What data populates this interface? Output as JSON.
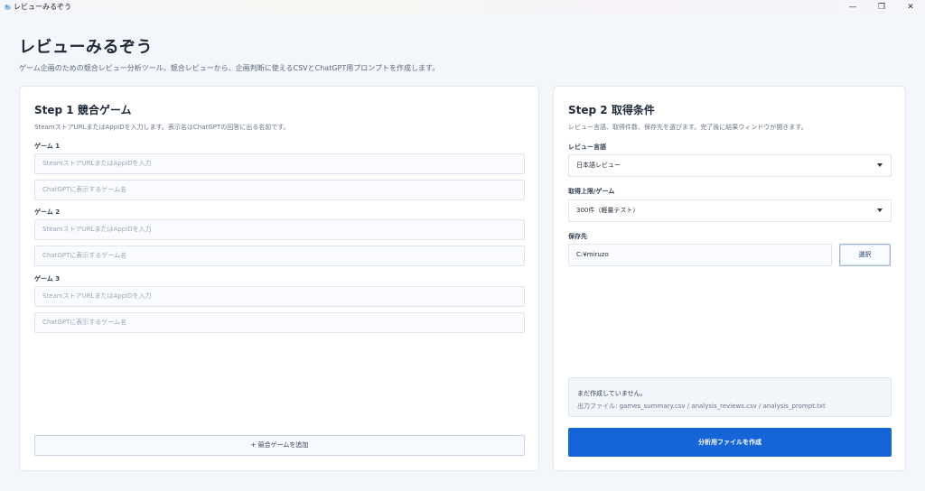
{
  "window": {
    "title": "レビューみるぞう",
    "minimize_glyph": "—",
    "maximize_glyph": "❐",
    "close_glyph": "✕"
  },
  "header": {
    "title": "レビューみるぞう",
    "subtitle": "ゲーム企画のための競合レビュー分析ツール。競合レビューから、企画判断に使えるCSVとChatGPT用プロンプトを作成します。"
  },
  "step1": {
    "title": "Step 1 競合ゲーム",
    "description": "SteamストアURLまたはAppIDを入力します。表示名はChatGPTの回答に出る名前です。",
    "games": [
      {
        "label": "ゲーム 1",
        "url_placeholder": "SteamストアURLまたはAppIDを入力",
        "name_placeholder": "ChatGPTに表示するゲーム名"
      },
      {
        "label": "ゲーム 2",
        "url_placeholder": "SteamストアURLまたはAppIDを入力",
        "name_placeholder": "ChatGPTに表示するゲーム名"
      },
      {
        "label": "ゲーム 3",
        "url_placeholder": "SteamストアURLまたはAppIDを入力",
        "name_placeholder": "ChatGPTに表示するゲーム名"
      }
    ],
    "add_button": "+ 競合ゲームを追加"
  },
  "step2": {
    "title": "Step 2 取得条件",
    "description": "レビュー言語、取得件数、保存先を選びます。完了後に結果ウィンドウが開きます。",
    "language_label": "レビュー言語",
    "language_value": "日本語レビュー",
    "limit_label": "取得上限/ゲーム",
    "limit_value": "300件（軽量テスト）",
    "save_label": "保存先",
    "save_value": "C:¥miruzo",
    "select_button": "選択",
    "status_line": "まだ作成していません。",
    "output_line": "出力ファイル: games_summary.csv / analysis_reviews.csv / analysis_prompt.txt",
    "create_button": "分析用ファイルを作成"
  },
  "colors": {
    "accent": "#1565d8",
    "background": "#f3f7fc",
    "card": "#ffffff"
  }
}
